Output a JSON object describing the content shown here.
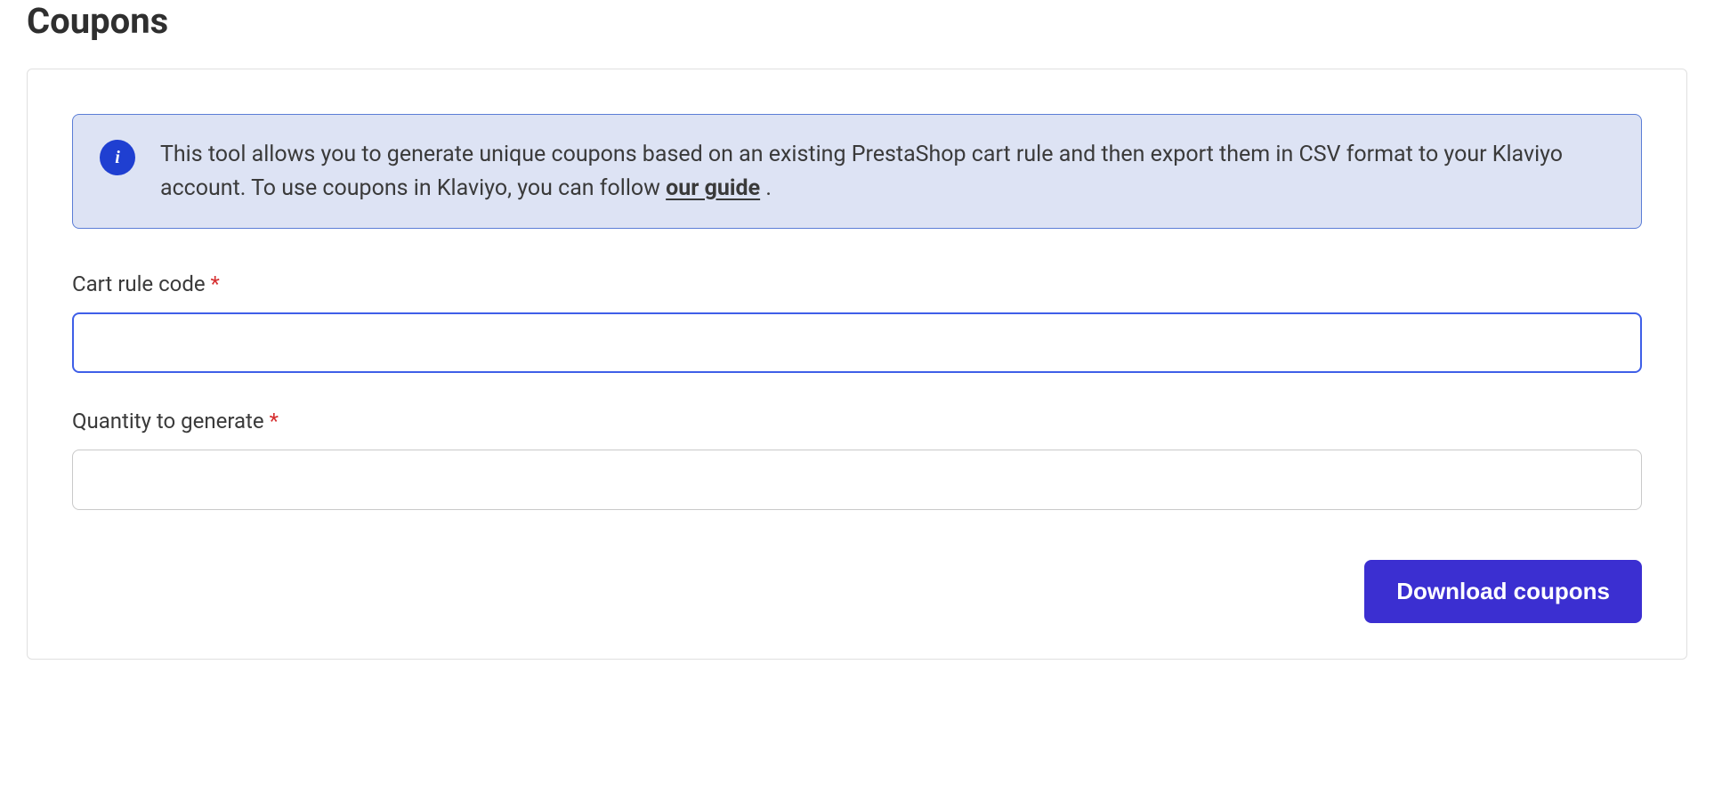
{
  "page_title": "Coupons",
  "info": {
    "icon_letter": "i",
    "text_before_link": "This tool allows you to generate unique coupons based on an existing PrestaShop cart rule and then export them in CSV format to your Klaviyo account. To use coupons in Klaviyo, you can follow ",
    "link_text": "our guide",
    "text_after_link": " ."
  },
  "form": {
    "cart_rule_label": "Cart rule code",
    "cart_rule_value": "",
    "quantity_label": "Quantity to generate",
    "quantity_value": "",
    "required_mark": "*"
  },
  "actions": {
    "download_label": "Download coupons"
  }
}
